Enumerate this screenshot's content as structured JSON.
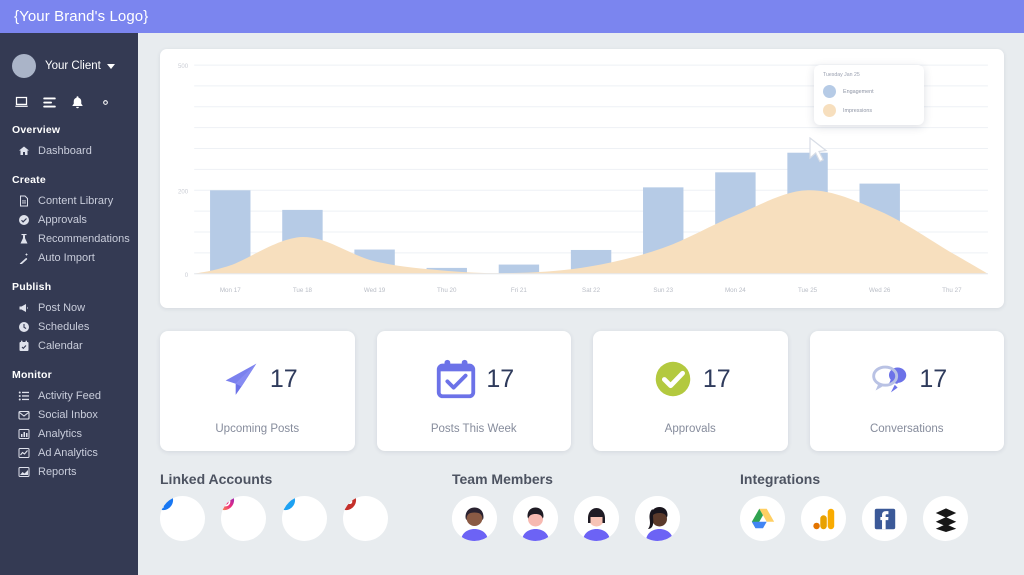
{
  "topbar": {
    "brand_logo": "{Your Brand's Logo}"
  },
  "sidebar": {
    "client": {
      "name": "Your Client",
      "avatar": "avatar-circle",
      "caret": "chevron-down-icon"
    },
    "quick_icons": [
      {
        "name": "laptop-icon"
      },
      {
        "name": "list-icon"
      },
      {
        "name": "bell-icon"
      },
      {
        "name": "gear-icon"
      }
    ],
    "groups": [
      {
        "title": "Overview",
        "items": [
          {
            "label": "Dashboard",
            "icon": "home-icon"
          }
        ]
      },
      {
        "title": "Create",
        "items": [
          {
            "label": "Content Library",
            "icon": "document-icon"
          },
          {
            "label": "Approvals",
            "icon": "check-circle-icon"
          },
          {
            "label": "Recommendations",
            "icon": "flask-icon"
          },
          {
            "label": "Auto Import",
            "icon": "magic-wand-icon"
          }
        ]
      },
      {
        "title": "Publish",
        "items": [
          {
            "label": "Post Now",
            "icon": "megaphone-icon"
          },
          {
            "label": "Schedules",
            "icon": "clock-icon"
          },
          {
            "label": "Calendar",
            "icon": "calendar-icon"
          }
        ]
      },
      {
        "title": "Monitor",
        "items": [
          {
            "label": "Activity Feed",
            "icon": "list-ul-icon"
          },
          {
            "label": "Social Inbox",
            "icon": "envelope-icon"
          },
          {
            "label": "Analytics",
            "icon": "bar-chart-icon"
          },
          {
            "label": "Ad Analytics",
            "icon": "line-chart-icon"
          },
          {
            "label": "Reports",
            "icon": "area-chart-icon"
          }
        ]
      }
    ]
  },
  "chart_data": {
    "type": "bar",
    "title": "",
    "xlabel": "",
    "ylabel": "",
    "grid": true,
    "ylim": [
      0,
      500
    ],
    "yticks": [
      0,
      200,
      500
    ],
    "ytick_labels": [
      "0",
      "200",
      "500"
    ],
    "categories": [
      "Mon 17",
      "Tue 18",
      "Wed 19",
      "Thu 20",
      "Fri 21",
      "Sat 22",
      "Sun 23",
      "Mon 24",
      "Tue 25",
      "Wed 26",
      "Thu 27"
    ],
    "series": [
      {
        "name": "Engagement",
        "type": "bar",
        "color": "#b6cbe6",
        "values": [
          200,
          153,
          58,
          14,
          22,
          57,
          207,
          243,
          290,
          216,
          0
        ]
      },
      {
        "name": "Impressions",
        "type": "area",
        "color": "#f7dfbe",
        "values": [
          20,
          88,
          30,
          7,
          2,
          18,
          62,
          140,
          200,
          150,
          50
        ]
      }
    ],
    "legend_position": "top-right",
    "tooltip": {
      "title": "Tuesday Jan 25",
      "rows": [
        {
          "label": "Engagement",
          "color": "#b6cbe6"
        },
        {
          "label": "Impressions",
          "color": "#f7dfbe"
        }
      ]
    }
  },
  "stats": [
    {
      "label": "Upcoming Posts",
      "value": "17",
      "icon": "paper-plane-icon",
      "color": "#6c72e8"
    },
    {
      "label": "Posts This Week",
      "value": "17",
      "icon": "calendar-check-icon",
      "color": "#6c72e8"
    },
    {
      "label": "Approvals",
      "value": "17",
      "icon": "check-circle-icon",
      "color": "#b3c93f"
    },
    {
      "label": "Conversations",
      "value": "17",
      "icon": "chat-bubbles-icon",
      "color": "#6c72e8"
    }
  ],
  "bottom": {
    "linked_accounts": {
      "title": "Linked Accounts",
      "items": [
        {
          "name": "facebook-icon",
          "color": "#1877f2"
        },
        {
          "name": "instagram-icon",
          "color": "#e1306c"
        },
        {
          "name": "twitter-icon",
          "color": "#1da1f2"
        },
        {
          "name": "youtube-icon",
          "color": "#c4302b"
        }
      ]
    },
    "team_members": {
      "title": "Team Members",
      "items": [
        {
          "name": "avatar-member-1"
        },
        {
          "name": "avatar-member-2"
        },
        {
          "name": "avatar-member-3"
        },
        {
          "name": "avatar-member-4"
        }
      ]
    },
    "integrations": {
      "title": "Integrations",
      "items": [
        {
          "name": "google-drive-icon"
        },
        {
          "name": "google-analytics-icon"
        },
        {
          "name": "facebook-icon"
        },
        {
          "name": "buffer-icon"
        }
      ]
    }
  }
}
